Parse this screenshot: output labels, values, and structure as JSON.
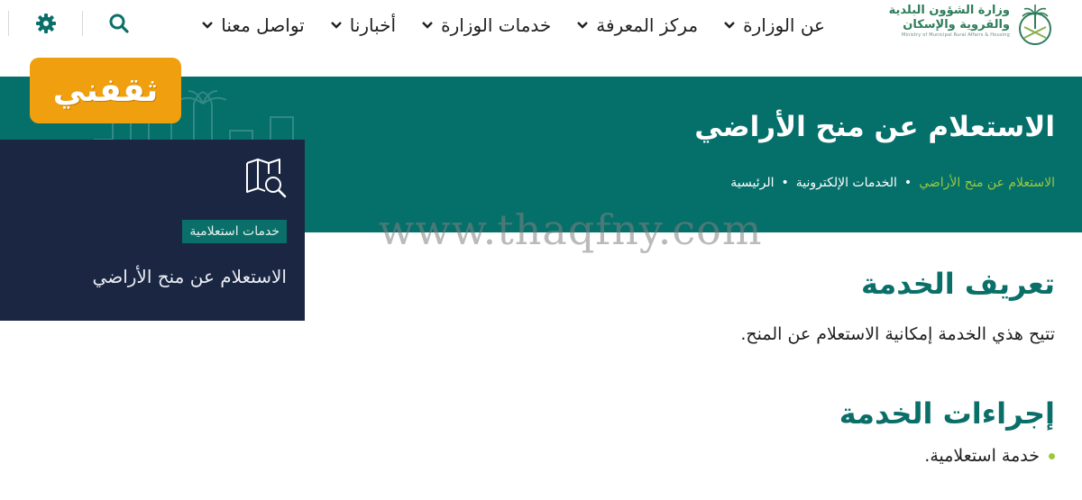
{
  "header": {
    "logo": {
      "line1": "وزارة الشؤون البلدية",
      "line2": "والقروية والإسكان",
      "line3": "Ministry of Municipal Rural Affairs & Housing"
    },
    "nav": [
      {
        "label": "عن الوزارة",
        "icon": "chevron-down-icon"
      },
      {
        "label": "مركز المعرفة",
        "icon": "chevron-down-icon"
      },
      {
        "label": "خدمات الوزارة",
        "icon": "chevron-down-icon"
      },
      {
        "label": "أخبارنا",
        "icon": "chevron-down-icon"
      },
      {
        "label": "تواصل معنا",
        "icon": "chevron-down-icon"
      }
    ],
    "tools": {
      "search_icon": "search-icon",
      "settings_icon": "gear-icon"
    }
  },
  "hero": {
    "title": "الاستعلام عن منح الأراضي",
    "breadcrumb": {
      "home": "الرئيسية",
      "services": "الخدمات الإلكترونية",
      "current": "الاستعلام عن منح الأراضي"
    }
  },
  "badge": {
    "text": "ثقفني"
  },
  "card": {
    "icon": "map-search-icon",
    "tag": "خدمات استعلامية",
    "title": "الاستعلام عن منح الأراضي"
  },
  "watermark": "www.thaqfny.com",
  "content": {
    "definition_heading": "تعريف الخدمة",
    "definition_text": "تتيح هذي الخدمة إمكانية الاستعلام عن المنح.",
    "procedures_heading": "إجراءات الخدمة",
    "procedures": [
      "خدمة استعلامية."
    ]
  },
  "colors": {
    "primary": "#056f6a",
    "heading": "#0b6f69",
    "accent": "#9cc93b",
    "badge": "#f09f0e",
    "card": "#1b2742"
  }
}
